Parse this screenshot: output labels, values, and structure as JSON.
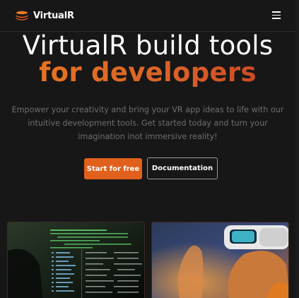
{
  "brand": {
    "name": "VirtualR",
    "logo_icon": "stacked-layers-logo",
    "accent_color": "#e0601c"
  },
  "navbar": {
    "menu_icon": "hamburger-menu-icon"
  },
  "hero": {
    "title": "VirtualR build tools",
    "subtitle": "for developers",
    "description": "Empower your creativity and bring your VR app ideas to life with our intuitive development tools. Get started today and turn your imagination inot immersive reality!",
    "primary_button": "Start for free",
    "secondary_button": "Documentation"
  },
  "media": [
    {
      "name": "code-screens-image"
    },
    {
      "name": "vr-headset-person-image"
    }
  ]
}
